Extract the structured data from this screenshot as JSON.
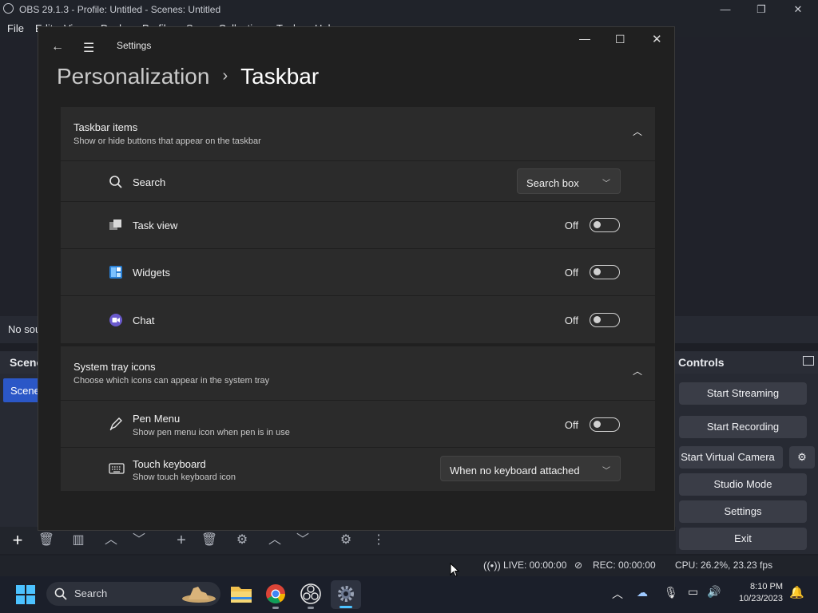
{
  "obs": {
    "window_title": "OBS 29.1.3 - Profile: Untitled - Scenes: Untitled",
    "menu": [
      "File",
      "Edit",
      "View",
      "Docks",
      "Profile",
      "Scene Collection",
      "Tools",
      "Help"
    ],
    "no_source_text": "No sou",
    "scenes_header": "Scene",
    "scene_item": "Scene",
    "controls_header": "Controls",
    "controls": [
      "Start Streaming",
      "Start Recording",
      "Start Virtual Camera",
      "Studio Mode",
      "Settings",
      "Exit"
    ],
    "status": {
      "live": "LIVE: 00:00:00",
      "rec": "REC: 00:00:00",
      "cpu": "CPU: 26.2%, 23.23 fps"
    }
  },
  "settings": {
    "title": "Settings",
    "breadcrumb_parent": "Personalization",
    "breadcrumb_current": "Taskbar",
    "taskbar_items": {
      "title": "Taskbar items",
      "subtitle": "Show or hide buttons that appear on the taskbar",
      "rows": [
        {
          "label": "Search",
          "control": "dropdown",
          "value": "Search box",
          "icon": "search-icon"
        },
        {
          "label": "Task view",
          "control": "toggle",
          "state": "Off",
          "icon": "task-view-icon"
        },
        {
          "label": "Widgets",
          "control": "toggle",
          "state": "Off",
          "icon": "widgets-icon"
        },
        {
          "label": "Chat",
          "control": "toggle",
          "state": "Off",
          "icon": "chat-icon"
        }
      ]
    },
    "system_tray": {
      "title": "System tray icons",
      "subtitle": "Choose which icons can appear in the system tray",
      "rows": [
        {
          "label": "Pen Menu",
          "sub": "Show pen menu icon when pen is in use",
          "control": "toggle",
          "state": "Off",
          "icon": "pen-icon"
        },
        {
          "label": "Touch keyboard",
          "sub": "Show touch keyboard icon",
          "control": "dropdown",
          "value": "When no keyboard attached",
          "icon": "keyboard-icon"
        }
      ]
    }
  },
  "taskbar": {
    "search_placeholder": "Search",
    "time": "8:10 PM",
    "date": "10/23/2023"
  }
}
